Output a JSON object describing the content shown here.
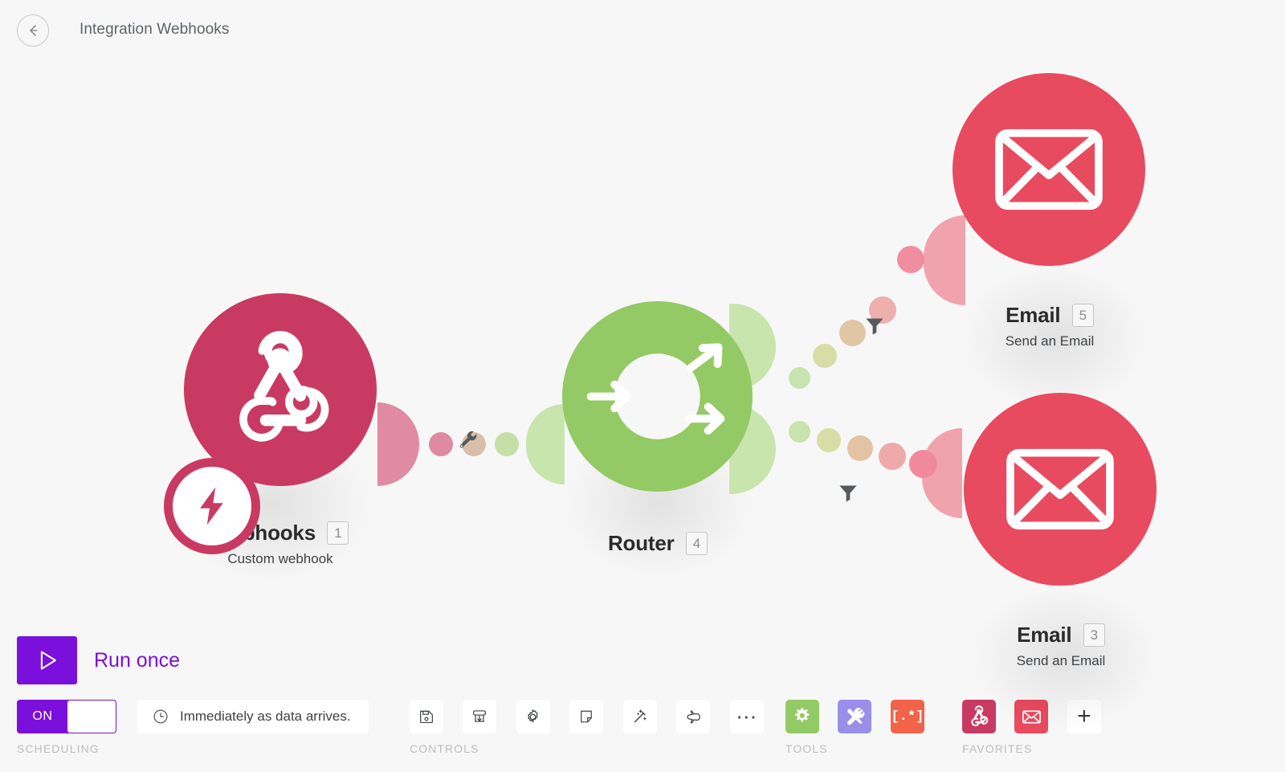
{
  "header": {
    "back_icon": "arrow-left-circle-icon",
    "title": "Integration Webhooks"
  },
  "canvas": {
    "nodes": [
      {
        "id": "webhooks",
        "title": "Webhooks",
        "badge": "1",
        "subtitle": "Custom webhook",
        "icon": "webhook-icon",
        "badge_icon": "lightning-bolt-icon",
        "color": "#c93a63",
        "stub_color": "#e08aa4"
      },
      {
        "id": "router",
        "title": "Router",
        "badge": "4",
        "subtitle": "",
        "icon": "router-arrows-icon",
        "color": "#94ca65",
        "stub_color": "#c9e5ae"
      },
      {
        "id": "email-5",
        "title": "Email",
        "badge": "5",
        "subtitle": "Send an Email",
        "icon": "envelope-icon",
        "color": "#e84a5f",
        "stub_color": "#f0a3ad"
      },
      {
        "id": "email-3",
        "title": "Email",
        "badge": "3",
        "subtitle": "Send an Email",
        "icon": "envelope-icon",
        "color": "#e84a5f",
        "stub_color": "#f0a3ad"
      }
    ],
    "connectors": [
      {
        "id": "webhooks-to-router",
        "tool_icon": "wrench-icon"
      },
      {
        "id": "router-to-email-5",
        "tool_icon": "filter-funnel-icon"
      },
      {
        "id": "router-to-email-3",
        "tool_icon": "filter-funnel-icon"
      }
    ]
  },
  "run_once": {
    "icon": "play-triangle-icon",
    "label": "Run once",
    "accent": "#7b0fdb"
  },
  "bottom_bar": {
    "scheduling": {
      "group_label": "SCHEDULING",
      "toggle_state": "ON",
      "schedule_icon": "clock-icon",
      "schedule_text": "Immediately as data arrives."
    },
    "controls": {
      "group_label": "CONTROLS",
      "buttons": [
        {
          "name": "save-button",
          "icon": "floppy-disk-icon"
        },
        {
          "name": "auto-align-button",
          "icon": "align-down-icon"
        },
        {
          "name": "settings-button",
          "icon": "gear-icon"
        },
        {
          "name": "note-button",
          "icon": "sticky-note-icon"
        },
        {
          "name": "auto-layout-button",
          "icon": "magic-wand-icon"
        },
        {
          "name": "explore-button",
          "icon": "paper-plane-icon"
        },
        {
          "name": "more-options-button",
          "icon": "ellipsis-icon"
        }
      ]
    },
    "tools": {
      "group_label": "TOOLS",
      "buttons": [
        {
          "name": "flow-control-button",
          "icon": "gear-icon",
          "color": "#94ca65"
        },
        {
          "name": "tools-button",
          "icon": "screwdriver-wrench-icon",
          "color": "#9b8ee8"
        },
        {
          "name": "text-parser-button",
          "icon": "regex-brackets-icon",
          "color": "#f2634a",
          "glyph": "[.*]"
        }
      ]
    },
    "favorites": {
      "group_label": "FAVORITES",
      "buttons": [
        {
          "name": "favorite-webhooks-button",
          "icon": "webhook-icon",
          "color": "#c93a63"
        },
        {
          "name": "favorite-email-button",
          "icon": "envelope-icon",
          "color": "#e84a5f"
        },
        {
          "name": "add-favorite-button",
          "icon": "plus-icon",
          "glyph": "+"
        }
      ]
    }
  }
}
